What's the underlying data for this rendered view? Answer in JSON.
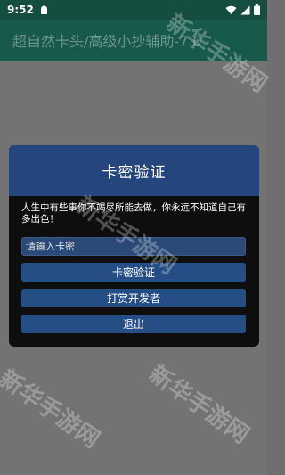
{
  "status_bar": {
    "time": "9:52",
    "left_icons": [
      "android-logo-icon"
    ],
    "right_icons": [
      "wifi-icon",
      "signal-icon",
      "battery-icon"
    ]
  },
  "app_bar": {
    "title": "超自然卡头/高级小抄辅助-7.0"
  },
  "dialog": {
    "title": "卡密验证",
    "message": "人生中有些事你不竭尽所能去做，你永远不知道自己有多出色！",
    "code_input": {
      "value": "",
      "placeholder": "请输入卡密"
    },
    "buttons": {
      "verify": "卡密验证",
      "tip_developer": "打赏开发者",
      "exit": "退出"
    }
  },
  "watermark": {
    "text": "新华手游网"
  },
  "colors": {
    "status_bar": "#164d41",
    "app_bar": "#17594a",
    "dialog_header": "#24467c",
    "dialog_body": "#0e0e0e",
    "button": "#254e86",
    "backdrop": "#737373"
  }
}
